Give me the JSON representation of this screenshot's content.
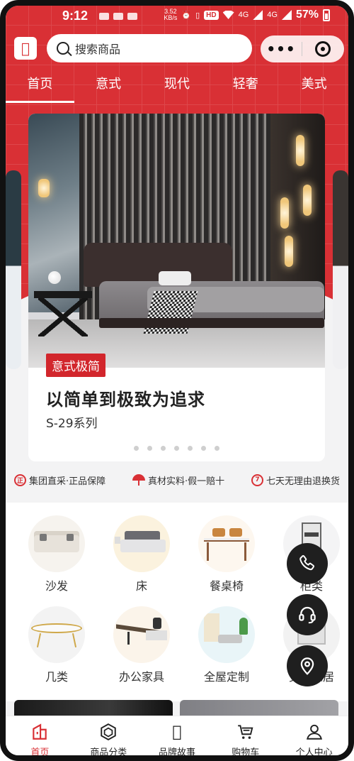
{
  "status_bar": {
    "time": "9:12",
    "net_speed": "3.52",
    "net_unit": "KB/s",
    "hd": "HD",
    "signal_1": "4G",
    "signal_2": "4G",
    "battery": "57%"
  },
  "header": {
    "logo_text": "𨱗",
    "search_placeholder": "搜索商品",
    "more_icon": "more-dots-icon",
    "close_icon": "target-icon"
  },
  "tabs": [
    {
      "label": "首页",
      "active": true
    },
    {
      "label": "意式",
      "active": false
    },
    {
      "label": "现代",
      "active": false
    },
    {
      "label": "轻奢",
      "active": false
    },
    {
      "label": "美式",
      "active": false
    }
  ],
  "banner": {
    "tag": "意式极简",
    "title": "以简单到极致为追求",
    "subtitle": "S-29系列",
    "page_count": 7,
    "current_page": 0
  },
  "guarantees": [
    {
      "icon": "zheng-badge-icon",
      "icon_text": "正",
      "text": "集团直采·正品保障"
    },
    {
      "icon": "umbrella-icon",
      "icon_text": "",
      "text": "真材实料·假一赔十"
    },
    {
      "icon": "seven-day-icon",
      "icon_text": "7",
      "text": "七天无理由退换货"
    }
  ],
  "categories": [
    {
      "label": "沙发",
      "icon": "sofa-image"
    },
    {
      "label": "床",
      "icon": "bed-image"
    },
    {
      "label": "餐桌椅",
      "icon": "dining-set-image"
    },
    {
      "label": "柜类",
      "icon": "cabinet-image"
    },
    {
      "label": "几类",
      "icon": "coffee-table-image"
    },
    {
      "label": "办公家具",
      "icon": "office-desk-image"
    },
    {
      "label": "全屋定制",
      "icon": "whole-house-image"
    },
    {
      "label": "更多家居",
      "icon": "more-furniture-image"
    }
  ],
  "floating_buttons": [
    {
      "name": "phone-icon"
    },
    {
      "name": "headset-icon"
    },
    {
      "name": "location-icon"
    }
  ],
  "bottom_nav": [
    {
      "label": "首页",
      "icon": "home-icon",
      "active": true
    },
    {
      "label": "商品分类",
      "icon": "category-icon",
      "active": false
    },
    {
      "label": "品牌故事",
      "icon": "brand-logo-icon",
      "active": false
    },
    {
      "label": "购物车",
      "icon": "cart-icon",
      "active": false
    },
    {
      "label": "个人中心",
      "icon": "user-icon",
      "active": false
    }
  ],
  "colors": {
    "brand_red": "#d93035",
    "tag_red": "#d2262c",
    "fab_dark": "#1f1f1f"
  }
}
